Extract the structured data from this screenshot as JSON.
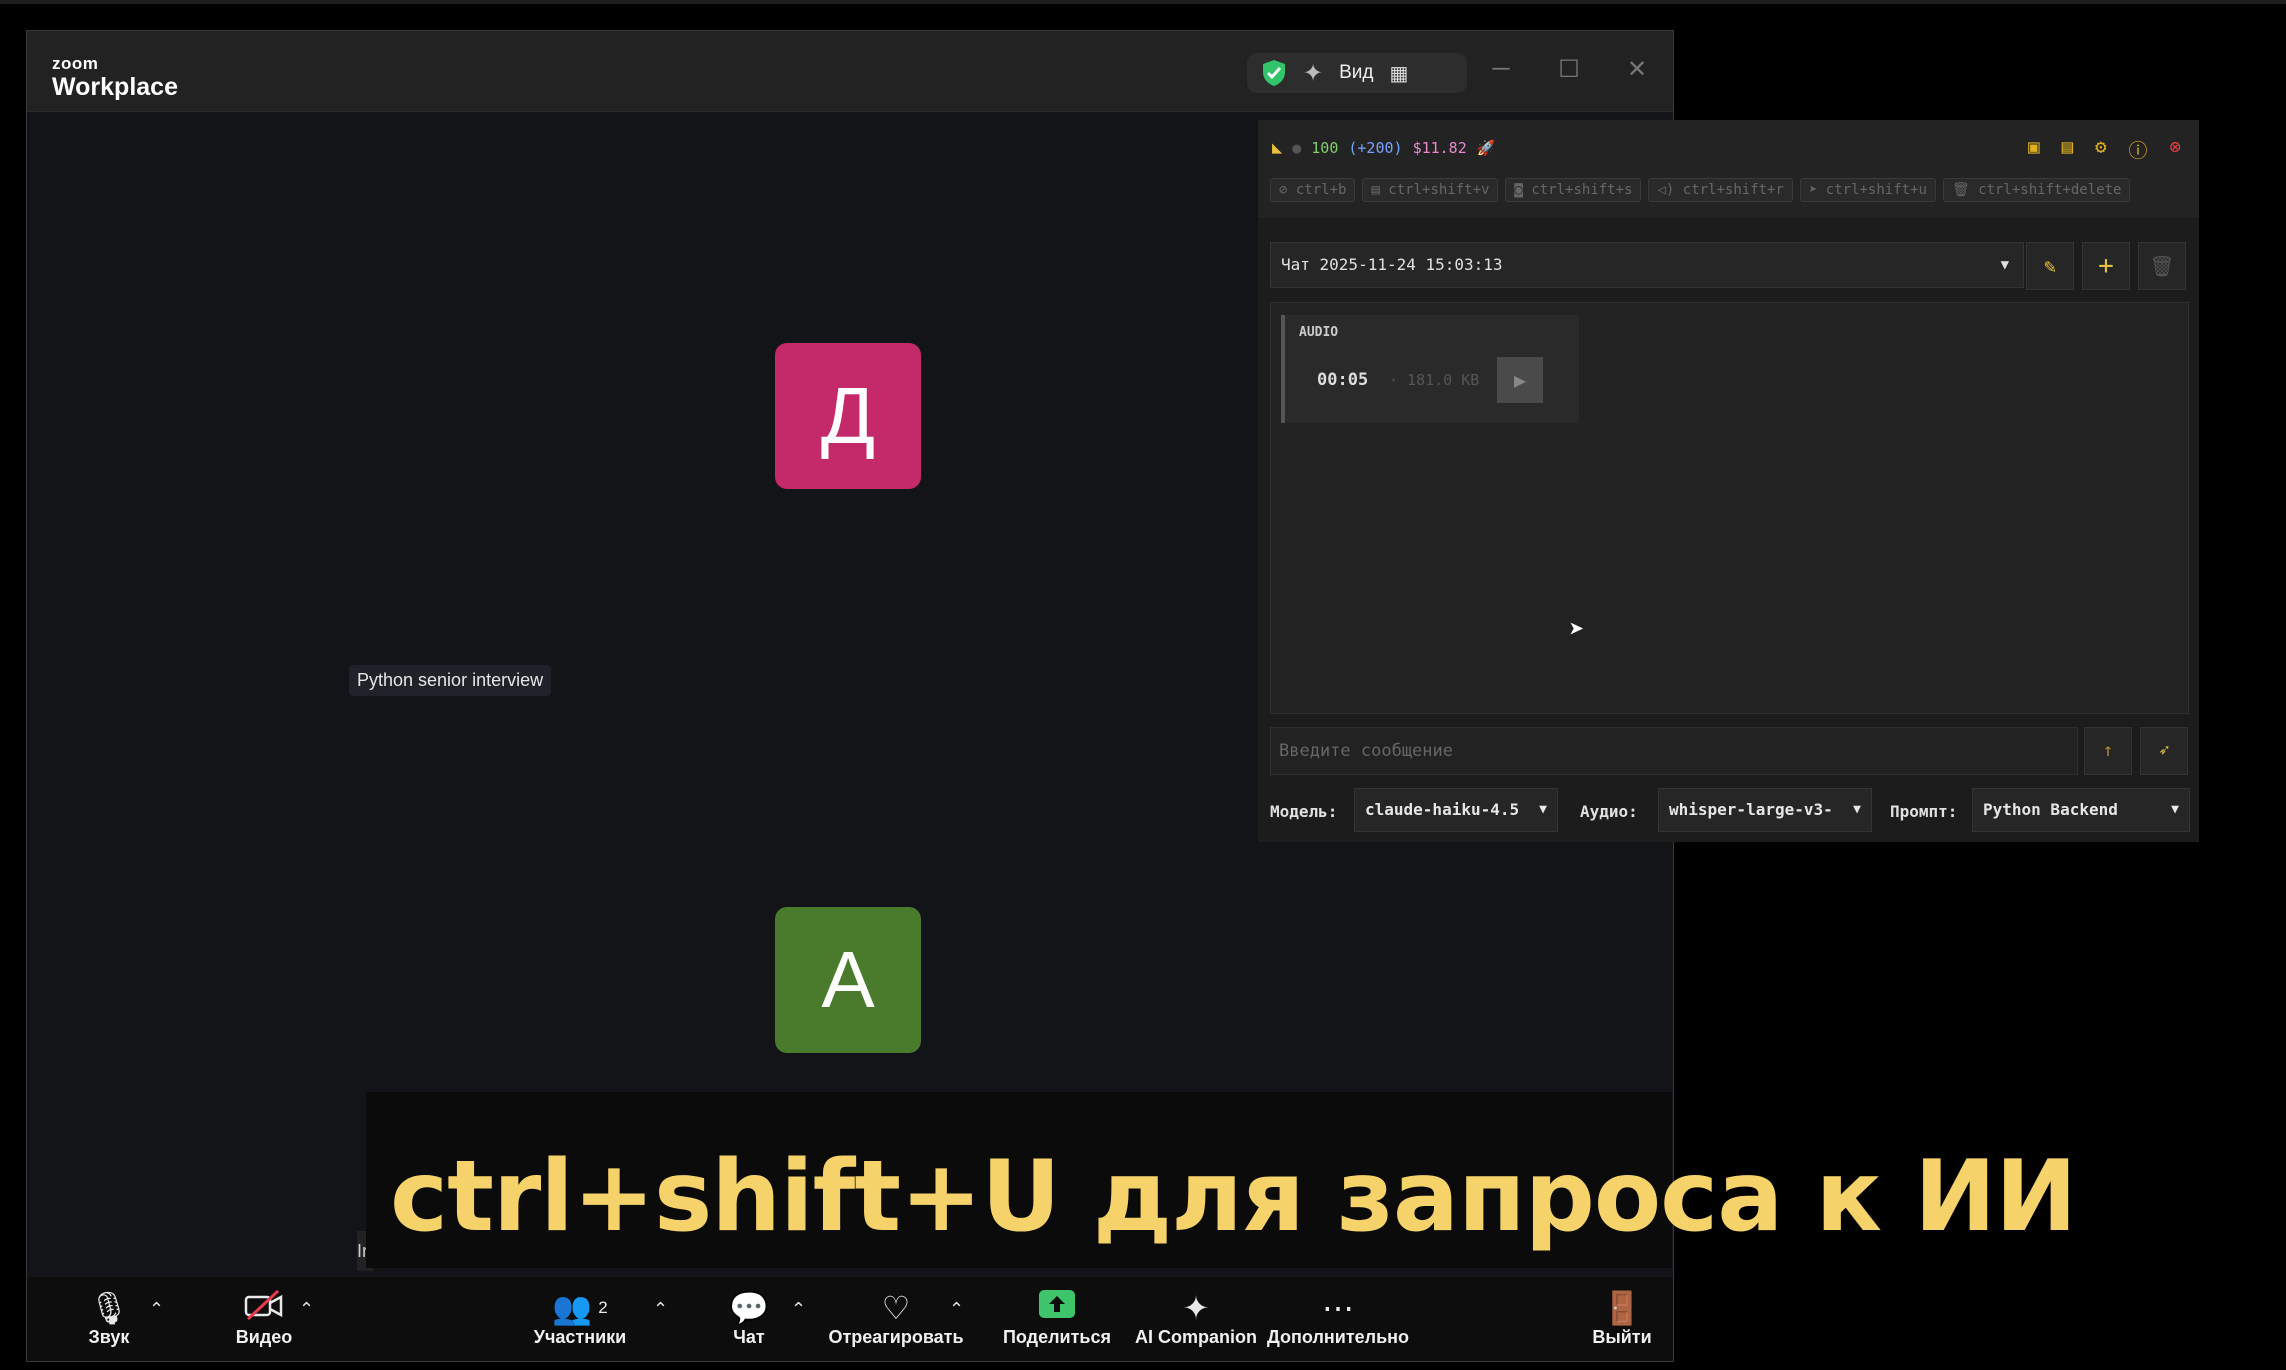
{
  "zoom": {
    "logo_small": "zoom",
    "logo_big": "Workplace",
    "view_label": "Вид",
    "avatar_1": "Д",
    "avatar_2": "А",
    "meeting_label": "Python senior interview",
    "cut_label": "Ir",
    "participants_count": "2",
    "toolbar": {
      "audio": "Звук",
      "video": "Видео",
      "participants": "Участники",
      "chat": "Чат",
      "react": "Отреагировать",
      "share": "Поделиться",
      "ai_companion": "AI Companion",
      "more": "Дополнительно",
      "leave": "Выйти"
    },
    "colors": {
      "avatar_1": "#c42a6a",
      "avatar_2": "#4a7a2c",
      "share_green": "#3ec46a"
    }
  },
  "ai_panel": {
    "stats": {
      "count": "100",
      "delta": "(+200)",
      "cost": "$11.82"
    },
    "hotkeys": [
      "ctrl+b",
      "ctrl+shift+v",
      "ctrl+shift+s",
      "ctrl+shift+r",
      "ctrl+shift+u",
      "ctrl+shift+delete"
    ],
    "chat_title": "Чат 2025-11-24 15:03:13",
    "audio_card": {
      "tag": "AUDIO",
      "duration": "00:05",
      "size": "· 181.0 KB"
    },
    "message_placeholder": "Введите сообщение",
    "model_label": "Модель:",
    "model_value": "claude-haiku-4.5",
    "audio_label": "Аудио:",
    "audio_value": "whisper-large-v3-",
    "prompt_label": "Промпт:",
    "prompt_value": "Python Backend",
    "accent": "#e8c040"
  },
  "caption": "ctrl+shift+U для запроса к ИИ"
}
